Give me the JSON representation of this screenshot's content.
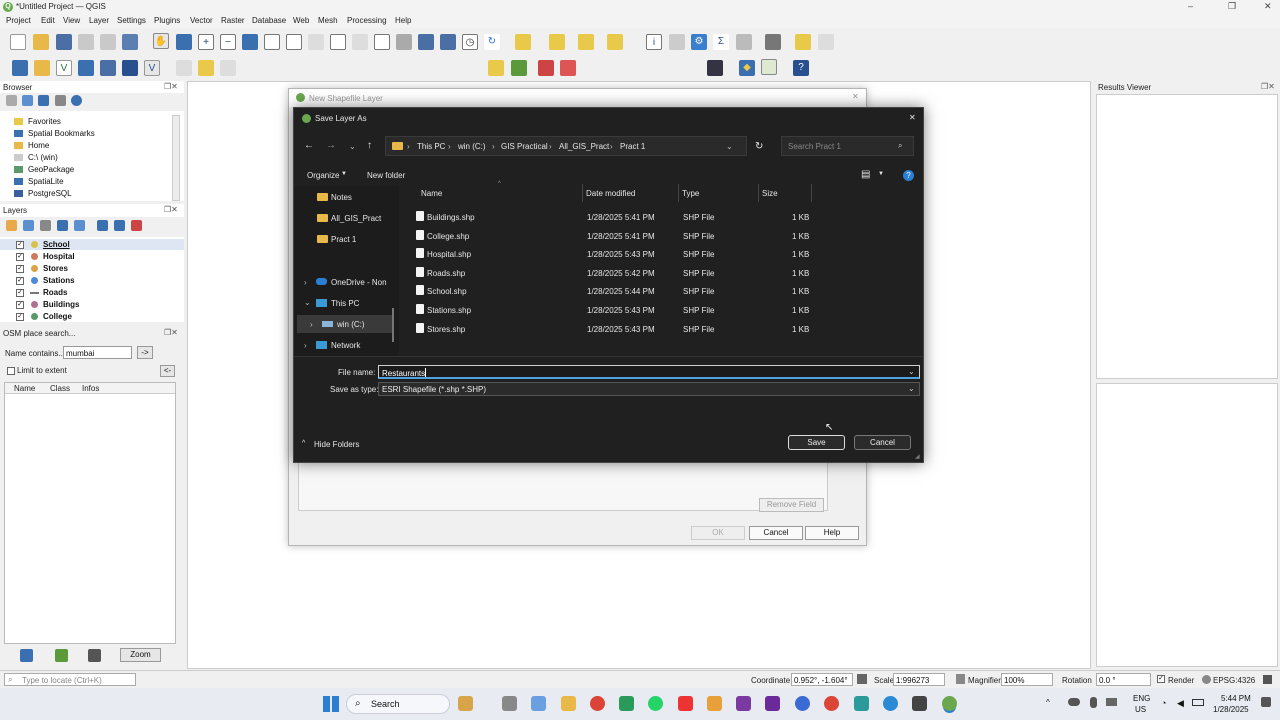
{
  "window": {
    "title": "*Untitled Project — QGIS",
    "min": "–",
    "max": "❐",
    "close": "✕"
  },
  "menu": [
    "Project",
    "Edit",
    "View",
    "Layer",
    "Settings",
    "Plugins",
    "Vector",
    "Raster",
    "Database",
    "Web",
    "Mesh",
    "Processing",
    "Help"
  ],
  "browser": {
    "title": "Browser",
    "items": [
      "Favorites",
      "Spatial Bookmarks",
      "Home",
      "C:\\ (win)",
      "GeoPackage",
      "SpatiaLite",
      "PostgreSQL"
    ]
  },
  "layers": {
    "title": "Layers",
    "items": [
      {
        "name": "School",
        "color": "#d8c24a",
        "type": "point"
      },
      {
        "name": "Hospital",
        "color": "#d07a5a",
        "type": "point"
      },
      {
        "name": "Stores",
        "color": "#d8a14a",
        "type": "point"
      },
      {
        "name": "Stations",
        "color": "#4a8ad8",
        "type": "point"
      },
      {
        "name": "Roads",
        "color": "#777777",
        "type": "line"
      },
      {
        "name": "Buildings",
        "color": "#b07090",
        "type": "point"
      },
      {
        "name": "College",
        "color": "#5a9a6a",
        "type": "point"
      }
    ]
  },
  "osm": {
    "title": "OSM place search...",
    "name_label": "Name contains...",
    "name_value": "mumbai",
    "go": "->",
    "limit": "Limit to extent",
    "back": "<-",
    "cols": [
      "Name",
      "Class",
      "Infos"
    ],
    "zoom": "Zoom"
  },
  "results": {
    "title": "Results Viewer"
  },
  "newshp": {
    "title": "New Shapefile Layer",
    "remove_field": "Remove Field",
    "ok": "OK",
    "cancel": "Cancel",
    "help": "Help"
  },
  "saveas": {
    "title": "Save Layer As",
    "path": [
      "This PC",
      "win (C:)",
      "GIS Practical",
      "All_GIS_Pract",
      "Pract 1"
    ],
    "search_placeholder": "Search Pract 1",
    "organize": "Organize",
    "new_folder": "New folder",
    "nav": [
      "Notes",
      "All_GIS_Pract",
      "Pract 1",
      "OneDrive - Non",
      "This PC",
      "win (C:)",
      "Network"
    ],
    "cols": [
      "Name",
      "Date modified",
      "Type",
      "Size"
    ],
    "files": [
      {
        "name": "Buildings.shp",
        "date": "1/28/2025 5:41 PM",
        "type": "SHP File",
        "size": "1 KB"
      },
      {
        "name": "College.shp",
        "date": "1/28/2025 5:41 PM",
        "type": "SHP File",
        "size": "1 KB"
      },
      {
        "name": "Hospital.shp",
        "date": "1/28/2025 5:43 PM",
        "type": "SHP File",
        "size": "1 KB"
      },
      {
        "name": "Roads.shp",
        "date": "1/28/2025 5:42 PM",
        "type": "SHP File",
        "size": "1 KB"
      },
      {
        "name": "School.shp",
        "date": "1/28/2025 5:44 PM",
        "type": "SHP File",
        "size": "1 KB"
      },
      {
        "name": "Stations.shp",
        "date": "1/28/2025 5:43 PM",
        "type": "SHP File",
        "size": "1 KB"
      },
      {
        "name": "Stores.shp",
        "date": "1/28/2025 5:43 PM",
        "type": "SHP File",
        "size": "1 KB"
      }
    ],
    "file_name_label": "File name:",
    "file_name": "Restaurants",
    "type_label": "Save as type:",
    "type_value": "ESRI Shapefile (*.shp *.SHP)",
    "hide_folders": "Hide Folders",
    "save": "Save",
    "cancel": "Cancel"
  },
  "status": {
    "locate_placeholder": "Type to locate (Ctrl+K)",
    "coord_label": "Coordinate",
    "coord": "0.952°, -1.604°",
    "scale_label": "Scale",
    "scale": "1:996273",
    "magnifier_label": "Magnifier",
    "magnifier": "100%",
    "rotation_label": "Rotation",
    "rotation": "0.0 °",
    "render": "Render",
    "crs": "EPSG:4326"
  },
  "taskbar": {
    "search": "Search",
    "lang1": "ENG",
    "lang2": "US",
    "time": "5:44 PM",
    "date": "1/28/2025"
  }
}
